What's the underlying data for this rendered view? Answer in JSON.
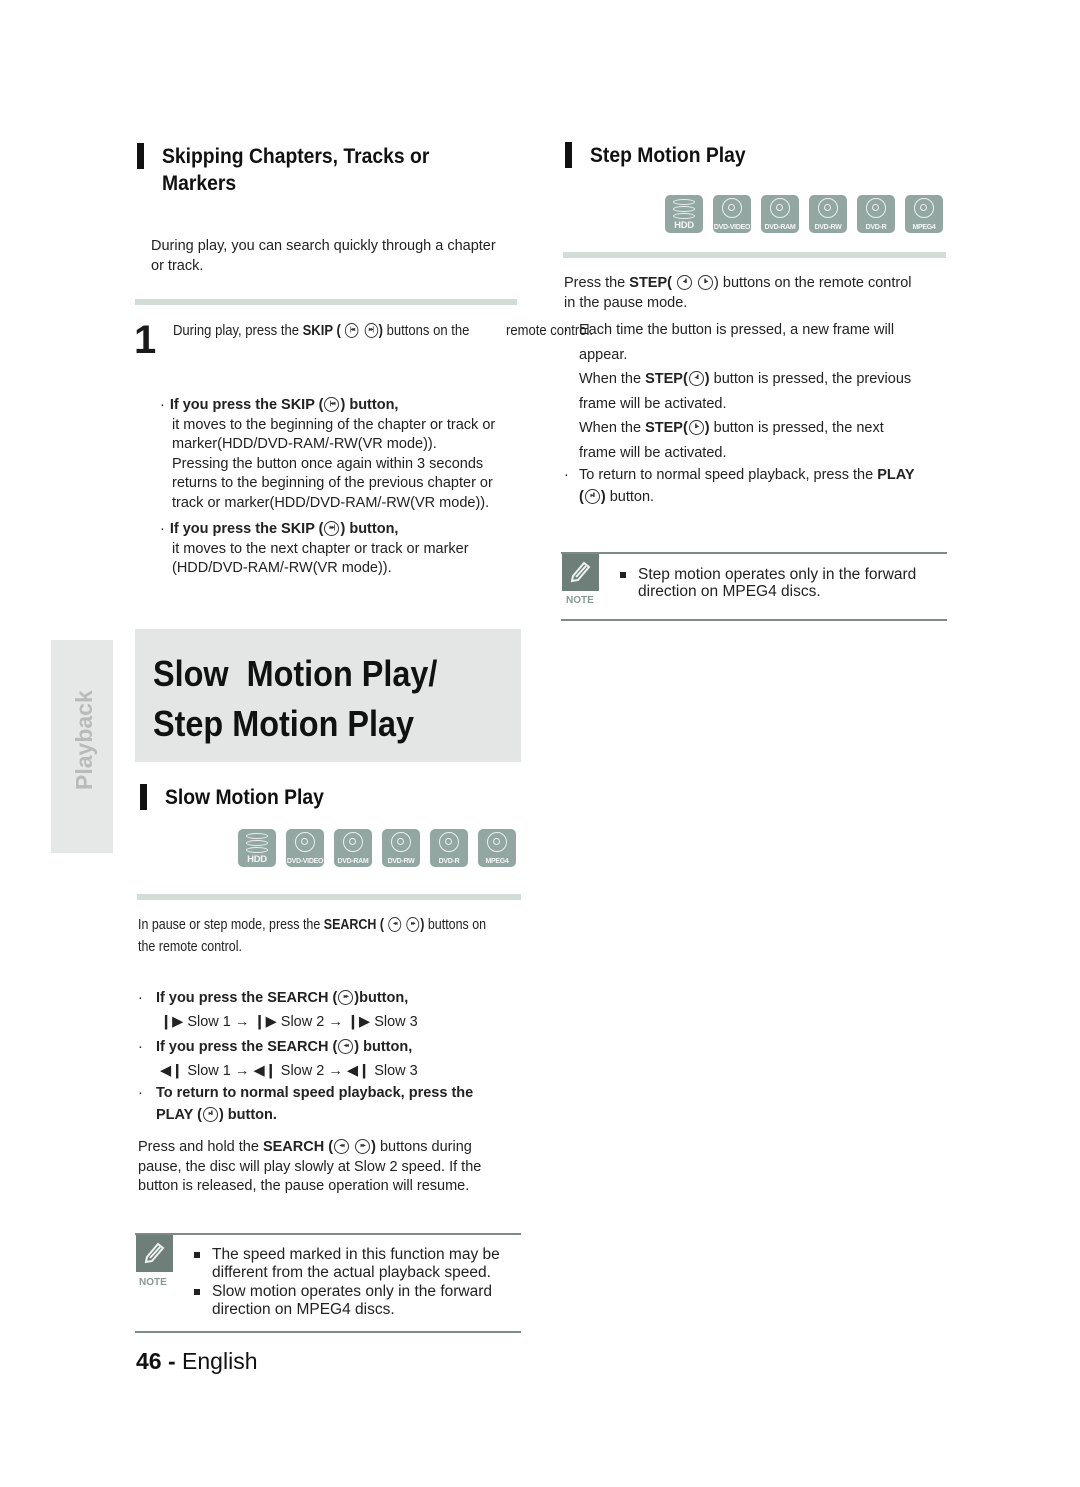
{
  "side_tab": {
    "label": "Playback"
  },
  "skipping": {
    "heading_line1": "Skipping Chapters, Tracks or",
    "heading_line2": "Markers",
    "intro_line1": "During play, you can search quickly through a chapter",
    "intro_line2": "or track.",
    "step_number": "1",
    "step_text_a": "During play, press the ",
    "step_text_bold": "SKIP (",
    "step_text_bold_end": ")",
    "step_text_b": " buttons on the",
    "step_text_line2": "remote control.",
    "bullet1_head_a": "If you press the SKIP (",
    "bullet1_head_b": ") button,",
    "bullet1_lines": [
      "it moves to the beginning of the chapter or track or",
      "marker(HDD/DVD-RAM/-RW(VR mode)).",
      "Pressing the button once again within 3 seconds",
      "returns to the beginning of the previous chapter or",
      "track or marker(HDD/DVD-RAM/-RW(VR mode))."
    ],
    "bullet2_head_a": "If you press the SKIP (",
    "bullet2_head_b": ") button,",
    "bullet2_lines": [
      "it moves to the next chapter or track or marker",
      "(HDD/DVD-RAM/-RW(VR mode))."
    ]
  },
  "banner": {
    "line1": "Slow  Motion Play/",
    "line2": "Step Motion Play"
  },
  "slow_motion": {
    "heading": "Slow Motion Play",
    "intro_a": "In pause or step mode, press the ",
    "intro_bold": "SEARCH (",
    "intro_bold_end": ")",
    "intro_b": " buttons on",
    "intro_line2": "the remote control.",
    "fwd_head_a": "If you press the SEARCH (",
    "fwd_head_b": ")button,",
    "fwd_seq": [
      "Slow 1",
      "Slow 2",
      "Slow 3"
    ],
    "rev_head_a": "If you press the SEARCH (",
    "rev_head_b": ") button,",
    "rev_seq": [
      "Slow 1",
      "Slow 2",
      "Slow 3"
    ],
    "return_line1": "To return to normal speed playback, press the",
    "return_line2_a": "PLAY (",
    "return_line2_b": ") button.",
    "hold_a": "Press and hold the ",
    "hold_bold": "SEARCH (",
    "hold_bold_end": ")",
    "hold_b": " buttons during",
    "hold_line2": "pause, the disc will play slowly at Slow 2 speed. If the",
    "hold_line3": "button is released, the pause operation will resume.",
    "note_label": "NOTE",
    "notes": [
      [
        "The speed marked in this function may be",
        "different from the actual playback speed."
      ],
      [
        "Slow motion operates only in the forward",
        "direction on MPEG4 discs."
      ]
    ]
  },
  "step_motion": {
    "heading": "Step Motion Play",
    "intro_a": "Press the ",
    "intro_bold": "STEP(",
    "intro_b": ") buttons on the remote control",
    "intro_line2": "in the pause mode.",
    "b1_line1": "Each time the button is pressed, a new frame will",
    "b1_line2": "appear.",
    "prev_a": "When the ",
    "prev_bold": "STEP(",
    "prev_bold_end": ")",
    "prev_b": " button is pressed, the previous",
    "prev_line2": "frame will be activated.",
    "next_a": "When the ",
    "next_bold": "STEP(",
    "next_bold_end": ")",
    "next_b": " button is pressed, the next",
    "next_line2": "frame will be activated.",
    "ret_a": "To return to normal speed playback, press the ",
    "ret_bold": "PLAY",
    "ret_line2_a": "(",
    "ret_line2_b": ")",
    "ret_line2_c": " button.",
    "note_label": "NOTE",
    "notes": [
      [
        "Step motion operates only in the forward",
        "direction on MPEG4 discs."
      ]
    ]
  },
  "disc_types": [
    "HDD",
    "DVD-VIDEO",
    "DVD-RAM",
    "DVD-RW",
    "DVD-R",
    "MPEG4"
  ],
  "footer": {
    "page_number": "46",
    "separator": " - ",
    "language": "English"
  },
  "colors": {
    "disc_badge": "#93a7a2",
    "separator_bar": "#d3ddd7",
    "banner_bg": "#e4e6e5",
    "side_tab_bg": "#e6e8e7",
    "note_icon_bg": "#6e7f7a"
  }
}
